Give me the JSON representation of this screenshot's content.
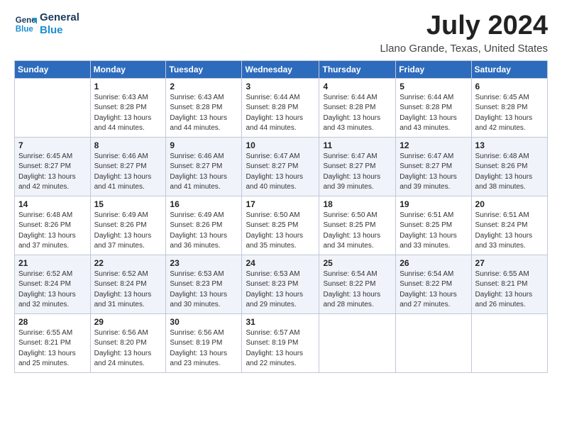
{
  "logo": {
    "line1": "General",
    "line2": "Blue"
  },
  "title": "July 2024",
  "location": "Llano Grande, Texas, United States",
  "days_of_week": [
    "Sunday",
    "Monday",
    "Tuesday",
    "Wednesday",
    "Thursday",
    "Friday",
    "Saturday"
  ],
  "weeks": [
    [
      {
        "day": "",
        "sunrise": "",
        "sunset": "",
        "daylight": "",
        "empty": true
      },
      {
        "day": "1",
        "sunrise": "Sunrise: 6:43 AM",
        "sunset": "Sunset: 8:28 PM",
        "daylight": "Daylight: 13 hours and 44 minutes."
      },
      {
        "day": "2",
        "sunrise": "Sunrise: 6:43 AM",
        "sunset": "Sunset: 8:28 PM",
        "daylight": "Daylight: 13 hours and 44 minutes."
      },
      {
        "day": "3",
        "sunrise": "Sunrise: 6:44 AM",
        "sunset": "Sunset: 8:28 PM",
        "daylight": "Daylight: 13 hours and 44 minutes."
      },
      {
        "day": "4",
        "sunrise": "Sunrise: 6:44 AM",
        "sunset": "Sunset: 8:28 PM",
        "daylight": "Daylight: 13 hours and 43 minutes."
      },
      {
        "day": "5",
        "sunrise": "Sunrise: 6:44 AM",
        "sunset": "Sunset: 8:28 PM",
        "daylight": "Daylight: 13 hours and 43 minutes."
      },
      {
        "day": "6",
        "sunrise": "Sunrise: 6:45 AM",
        "sunset": "Sunset: 8:28 PM",
        "daylight": "Daylight: 13 hours and 42 minutes."
      }
    ],
    [
      {
        "day": "7",
        "sunrise": "Sunrise: 6:45 AM",
        "sunset": "Sunset: 8:27 PM",
        "daylight": "Daylight: 13 hours and 42 minutes."
      },
      {
        "day": "8",
        "sunrise": "Sunrise: 6:46 AM",
        "sunset": "Sunset: 8:27 PM",
        "daylight": "Daylight: 13 hours and 41 minutes."
      },
      {
        "day": "9",
        "sunrise": "Sunrise: 6:46 AM",
        "sunset": "Sunset: 8:27 PM",
        "daylight": "Daylight: 13 hours and 41 minutes."
      },
      {
        "day": "10",
        "sunrise": "Sunrise: 6:47 AM",
        "sunset": "Sunset: 8:27 PM",
        "daylight": "Daylight: 13 hours and 40 minutes."
      },
      {
        "day": "11",
        "sunrise": "Sunrise: 6:47 AM",
        "sunset": "Sunset: 8:27 PM",
        "daylight": "Daylight: 13 hours and 39 minutes."
      },
      {
        "day": "12",
        "sunrise": "Sunrise: 6:47 AM",
        "sunset": "Sunset: 8:27 PM",
        "daylight": "Daylight: 13 hours and 39 minutes."
      },
      {
        "day": "13",
        "sunrise": "Sunrise: 6:48 AM",
        "sunset": "Sunset: 8:26 PM",
        "daylight": "Daylight: 13 hours and 38 minutes."
      }
    ],
    [
      {
        "day": "14",
        "sunrise": "Sunrise: 6:48 AM",
        "sunset": "Sunset: 8:26 PM",
        "daylight": "Daylight: 13 hours and 37 minutes."
      },
      {
        "day": "15",
        "sunrise": "Sunrise: 6:49 AM",
        "sunset": "Sunset: 8:26 PM",
        "daylight": "Daylight: 13 hours and 37 minutes."
      },
      {
        "day": "16",
        "sunrise": "Sunrise: 6:49 AM",
        "sunset": "Sunset: 8:26 PM",
        "daylight": "Daylight: 13 hours and 36 minutes."
      },
      {
        "day": "17",
        "sunrise": "Sunrise: 6:50 AM",
        "sunset": "Sunset: 8:25 PM",
        "daylight": "Daylight: 13 hours and 35 minutes."
      },
      {
        "day": "18",
        "sunrise": "Sunrise: 6:50 AM",
        "sunset": "Sunset: 8:25 PM",
        "daylight": "Daylight: 13 hours and 34 minutes."
      },
      {
        "day": "19",
        "sunrise": "Sunrise: 6:51 AM",
        "sunset": "Sunset: 8:25 PM",
        "daylight": "Daylight: 13 hours and 33 minutes."
      },
      {
        "day": "20",
        "sunrise": "Sunrise: 6:51 AM",
        "sunset": "Sunset: 8:24 PM",
        "daylight": "Daylight: 13 hours and 33 minutes."
      }
    ],
    [
      {
        "day": "21",
        "sunrise": "Sunrise: 6:52 AM",
        "sunset": "Sunset: 8:24 PM",
        "daylight": "Daylight: 13 hours and 32 minutes."
      },
      {
        "day": "22",
        "sunrise": "Sunrise: 6:52 AM",
        "sunset": "Sunset: 8:24 PM",
        "daylight": "Daylight: 13 hours and 31 minutes."
      },
      {
        "day": "23",
        "sunrise": "Sunrise: 6:53 AM",
        "sunset": "Sunset: 8:23 PM",
        "daylight": "Daylight: 13 hours and 30 minutes."
      },
      {
        "day": "24",
        "sunrise": "Sunrise: 6:53 AM",
        "sunset": "Sunset: 8:23 PM",
        "daylight": "Daylight: 13 hours and 29 minutes."
      },
      {
        "day": "25",
        "sunrise": "Sunrise: 6:54 AM",
        "sunset": "Sunset: 8:22 PM",
        "daylight": "Daylight: 13 hours and 28 minutes."
      },
      {
        "day": "26",
        "sunrise": "Sunrise: 6:54 AM",
        "sunset": "Sunset: 8:22 PM",
        "daylight": "Daylight: 13 hours and 27 minutes."
      },
      {
        "day": "27",
        "sunrise": "Sunrise: 6:55 AM",
        "sunset": "Sunset: 8:21 PM",
        "daylight": "Daylight: 13 hours and 26 minutes."
      }
    ],
    [
      {
        "day": "28",
        "sunrise": "Sunrise: 6:55 AM",
        "sunset": "Sunset: 8:21 PM",
        "daylight": "Daylight: 13 hours and 25 minutes."
      },
      {
        "day": "29",
        "sunrise": "Sunrise: 6:56 AM",
        "sunset": "Sunset: 8:20 PM",
        "daylight": "Daylight: 13 hours and 24 minutes."
      },
      {
        "day": "30",
        "sunrise": "Sunrise: 6:56 AM",
        "sunset": "Sunset: 8:19 PM",
        "daylight": "Daylight: 13 hours and 23 minutes."
      },
      {
        "day": "31",
        "sunrise": "Sunrise: 6:57 AM",
        "sunset": "Sunset: 8:19 PM",
        "daylight": "Daylight: 13 hours and 22 minutes."
      },
      {
        "day": "",
        "sunrise": "",
        "sunset": "",
        "daylight": "",
        "empty": true
      },
      {
        "day": "",
        "sunrise": "",
        "sunset": "",
        "daylight": "",
        "empty": true
      },
      {
        "day": "",
        "sunrise": "",
        "sunset": "",
        "daylight": "",
        "empty": true
      }
    ]
  ]
}
